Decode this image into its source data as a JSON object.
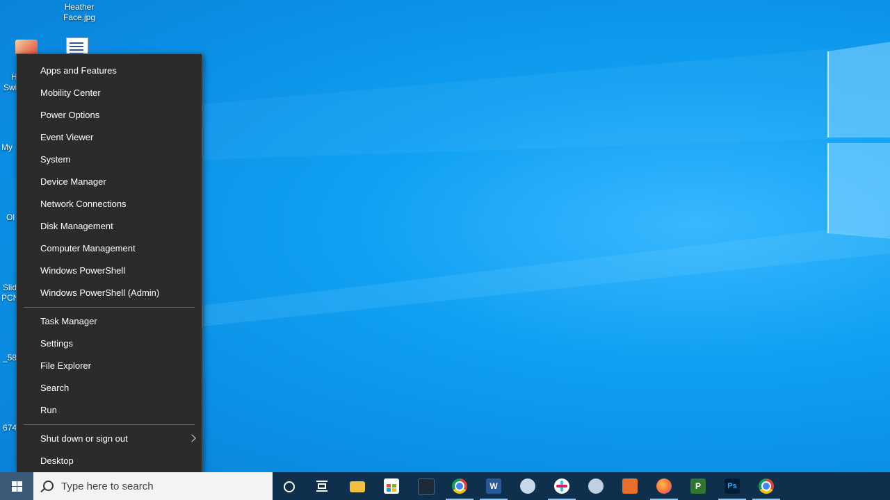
{
  "desktop": {
    "icons": [
      {
        "label_line1": "Heather",
        "label_line2": "Face.jpg"
      }
    ],
    "side_labels": [
      "H",
      "Swi",
      "My",
      "Ol",
      "Slid",
      "PCN",
      "_58/",
      "674"
    ]
  },
  "context_menu": {
    "group1": [
      "Apps and Features",
      "Mobility Center",
      "Power Options",
      "Event Viewer",
      "System",
      "Device Manager",
      "Network Connections",
      "Disk Management",
      "Computer Management",
      "Windows PowerShell",
      "Windows PowerShell (Admin)"
    ],
    "group2": [
      "Task Manager",
      "Settings",
      "File Explorer",
      "Search",
      "Run"
    ],
    "group3": [
      "Shut down or sign out",
      "Desktop"
    ]
  },
  "taskbar": {
    "search_placeholder": "Type here to search",
    "apps": [
      {
        "name": "file-explorer",
        "color": "#f0c040"
      },
      {
        "name": "microsoft-store",
        "color": "#ffffff"
      },
      {
        "name": "app-dark",
        "color": "#1c2a3a"
      },
      {
        "name": "chrome",
        "color": "#4285f4"
      },
      {
        "name": "word",
        "color": "#2b579a",
        "glyph": "W"
      },
      {
        "name": "paint",
        "color": "#c8d8e8"
      },
      {
        "name": "slack",
        "color": "#ffffff"
      },
      {
        "name": "snip",
        "color": "#c0d0e0"
      },
      {
        "name": "app-orange",
        "color": "#e8702a"
      },
      {
        "name": "firefox",
        "color": "#ff7139"
      },
      {
        "name": "project",
        "color": "#31752f",
        "glyph": "P"
      },
      {
        "name": "photoshop",
        "color": "#001e36",
        "glyph": "Ps"
      },
      {
        "name": "chrome-2",
        "color": "#4285f4"
      }
    ]
  },
  "colors": {
    "menu_bg": "#2b2b2b",
    "menu_text": "#ffffff",
    "taskbar_bg": "#102840",
    "desktop_accent": "#0a8ee3"
  }
}
